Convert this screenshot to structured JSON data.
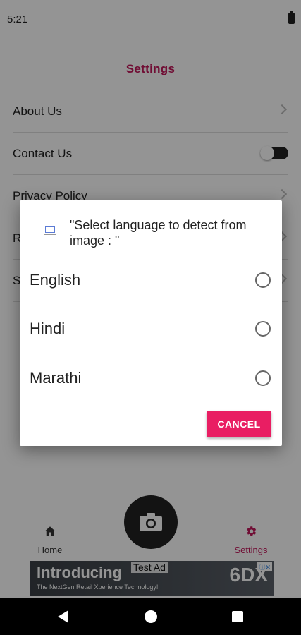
{
  "status_bar": {
    "time": "5:21"
  },
  "header": {
    "title": "Settings"
  },
  "settings": {
    "items": [
      {
        "label": "About Us"
      },
      {
        "label": "Contact Us"
      },
      {
        "label": "Privacy Policy"
      },
      {
        "label": "R"
      },
      {
        "label": "S"
      }
    ]
  },
  "bottom_nav": {
    "home_label": "Home",
    "settings_label": "Settings",
    "active": "Settings"
  },
  "ad": {
    "headline": "Introducing",
    "subtext": "The NextGen Retail Xperience Technology!",
    "brand": "6DX",
    "test_label": "Test Ad"
  },
  "dialog": {
    "title": "\"Select language to detect from image : \"",
    "options": [
      {
        "label": "English",
        "selected": false
      },
      {
        "label": "Hindi",
        "selected": false
      },
      {
        "label": "Marathi",
        "selected": false
      }
    ],
    "cancel_label": "CANCEL"
  },
  "colors": {
    "accent": "#c2185b",
    "button": "#e91e63",
    "scrim": "rgba(0,0,0,0.42)"
  }
}
